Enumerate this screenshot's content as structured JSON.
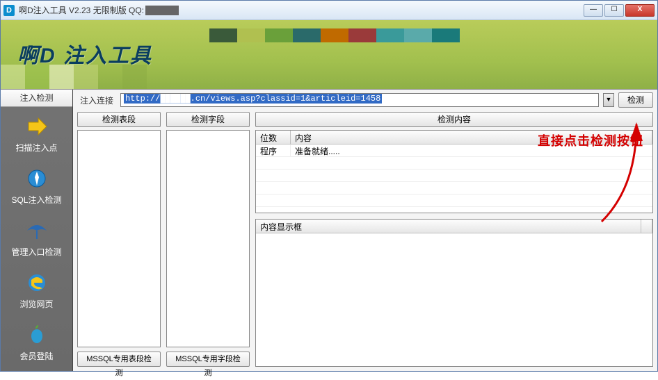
{
  "title_prefix": "啊D注入工具 V2.23 无限制版 QQ:",
  "win": {
    "min": "—",
    "max": "☐",
    "close": "X"
  },
  "banner_title": "啊D 注入工具",
  "sidebar_tab": "注入检测",
  "sidebar": {
    "items": [
      {
        "label": "扫描注入点"
      },
      {
        "label": "SQL注入检测"
      },
      {
        "label": "管理入口检测"
      },
      {
        "label": "浏览网页"
      },
      {
        "label": "会员登陆"
      }
    ]
  },
  "url_label": "注入连接",
  "url_value_prefix": "http://",
  "url_value_suffix": ".cn/views.asp?classid=1&articleid=1458",
  "btn_detect": "检测",
  "btn_detect_table": "检测表段",
  "btn_detect_field": "检测字段",
  "btn_detect_content": "检测内容",
  "grid_headers": {
    "c1": "位数",
    "c2": "内容"
  },
  "grid_rows": [
    {
      "c1": "程序",
      "c2": "准备就绪....."
    }
  ],
  "content_header": "内容显示框",
  "btn_mssql_table": "MSSQL专用表段检测",
  "btn_mssql_field": "MSSQL专用字段检测",
  "annotation": "直接点击检测按钮"
}
